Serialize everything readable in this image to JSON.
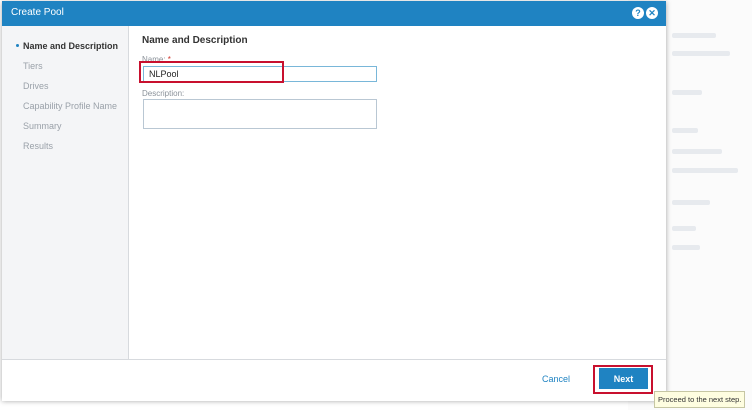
{
  "dialog": {
    "title": "Create Pool",
    "icons": [
      "help-icon",
      "close-icon"
    ]
  },
  "nav": {
    "items": [
      {
        "label": "Name and Description",
        "active": true
      },
      {
        "label": "Tiers",
        "active": false
      },
      {
        "label": "Drives",
        "active": false
      },
      {
        "label": "Capability Profile Name",
        "active": false
      },
      {
        "label": "Summary",
        "active": false
      },
      {
        "label": "Results",
        "active": false
      }
    ]
  },
  "form": {
    "heading": "Name and Description",
    "name_label": "Name:",
    "required_mark": "*",
    "name_value": "NLPool",
    "description_label": "Description:",
    "description_value": ""
  },
  "footer": {
    "cancel_label": "Cancel",
    "next_label": "Next"
  },
  "tooltip": {
    "text": "Proceed to the next step."
  },
  "colors": {
    "accent": "#1f83c2",
    "highlight": "#c8102e"
  }
}
